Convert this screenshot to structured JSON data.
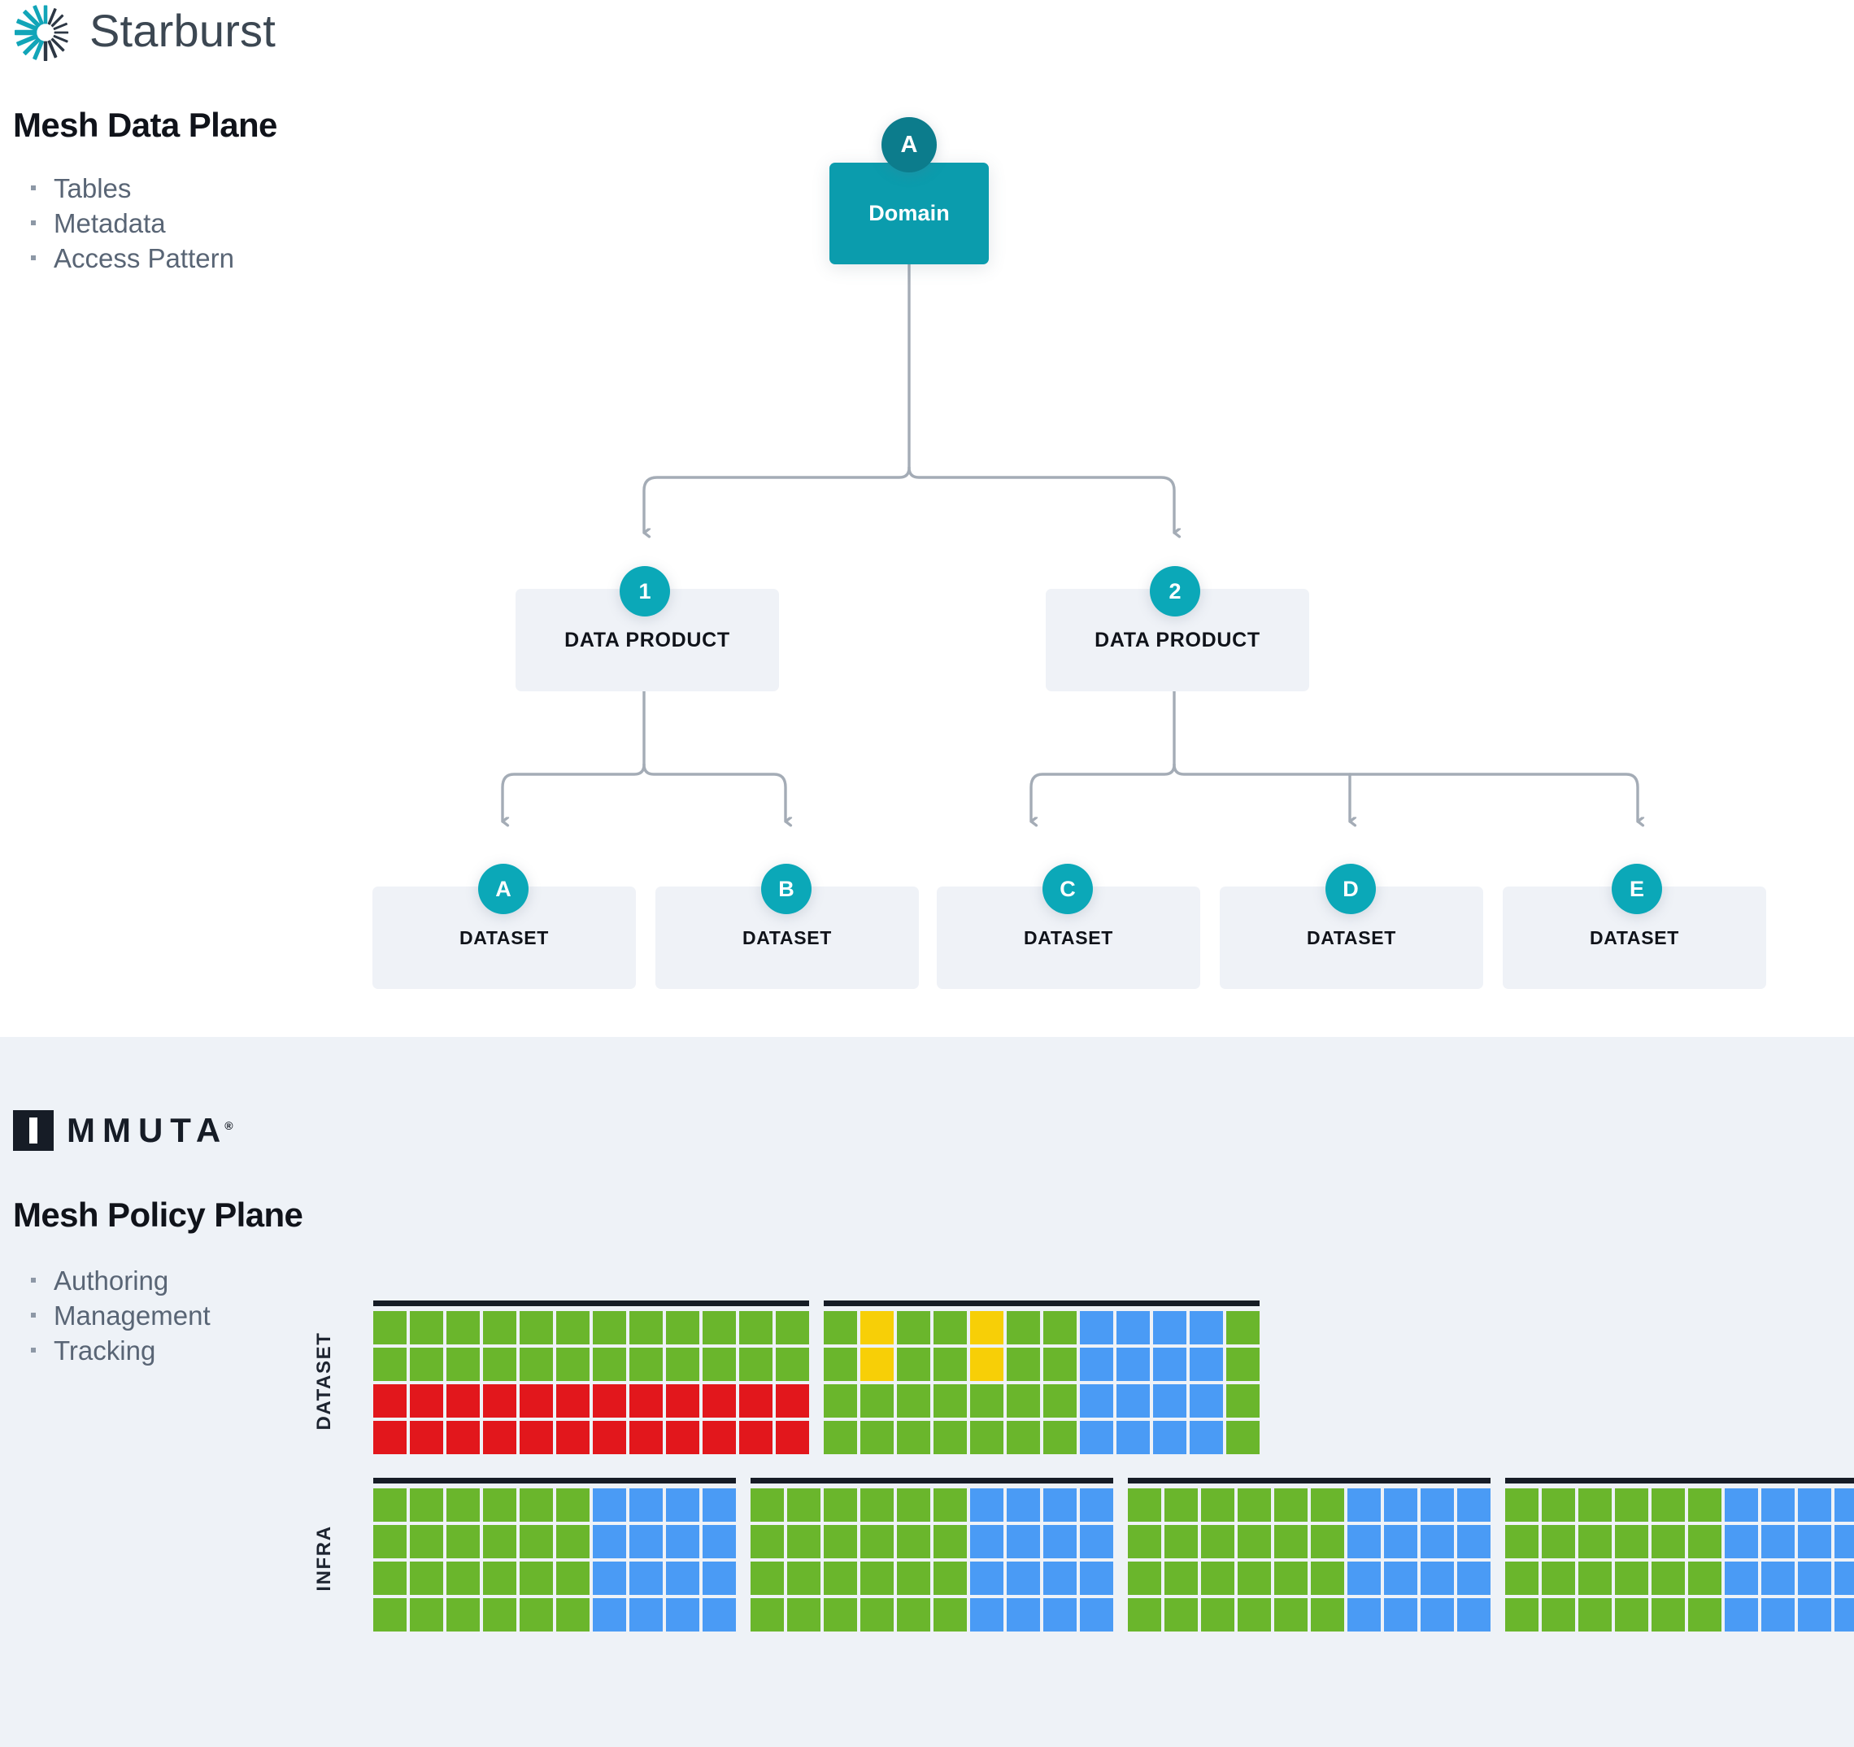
{
  "colors": {
    "teal": "#0b9cad",
    "teal_dark": "#0c7c8c",
    "teal_badge": "#0ba8b8",
    "box_gray": "#eff2f7",
    "section_bg": "#eef2f7",
    "connector": "#a4acb6",
    "green": "#6ab62c",
    "red": "#e2171c",
    "yellow": "#f7cf07",
    "blue": "#4a9bf5",
    "ink": "#161c26"
  },
  "data_plane": {
    "logo": {
      "brand": "Starburst",
      "mark": "starburst-radial-mark"
    },
    "heading": "Mesh Data Plane",
    "bullets": [
      "Tables",
      "Metadata",
      "Access Pattern"
    ],
    "diagram": {
      "domain": {
        "badge": "A",
        "label": "Domain"
      },
      "data_products": [
        {
          "badge": "1",
          "label": "DATA PRODUCT"
        },
        {
          "badge": "2",
          "label": "DATA PRODUCT"
        }
      ],
      "datasets": [
        {
          "badge": "A",
          "label": "DATASET",
          "parent": "1"
        },
        {
          "badge": "B",
          "label": "DATASET",
          "parent": "1"
        },
        {
          "badge": "C",
          "label": "DATASET",
          "parent": "2"
        },
        {
          "badge": "D",
          "label": "DATASET",
          "parent": "2"
        },
        {
          "badge": "E",
          "label": "DATASET",
          "parent": "2"
        }
      ]
    }
  },
  "policy_plane": {
    "logo": {
      "brand": "MMUTA",
      "registered": "®",
      "mark": "immuta-i-block"
    },
    "heading": "Mesh Policy Plane",
    "bullets": [
      "Authoring",
      "Management",
      "Tracking"
    ],
    "matrix": {
      "rows": [
        {
          "label": "DATASET",
          "blocks": [
            {
              "columns": 12,
              "grid": [
                [
                  "green",
                  "green",
                  "green",
                  "green",
                  "green",
                  "green",
                  "green",
                  "green",
                  "green",
                  "green",
                  "green",
                  "green"
                ],
                [
                  "green",
                  "green",
                  "green",
                  "green",
                  "green",
                  "green",
                  "green",
                  "green",
                  "green",
                  "green",
                  "green",
                  "green"
                ],
                [
                  "red",
                  "red",
                  "red",
                  "red",
                  "red",
                  "red",
                  "red",
                  "red",
                  "red",
                  "red",
                  "red",
                  "red"
                ],
                [
                  "red",
                  "red",
                  "red",
                  "red",
                  "red",
                  "red",
                  "red",
                  "red",
                  "red",
                  "red",
                  "red",
                  "red"
                ]
              ]
            },
            {
              "columns": 12,
              "grid": [
                [
                  "green",
                  "yellow",
                  "green",
                  "green",
                  "yellow",
                  "green",
                  "green",
                  "blue",
                  "blue",
                  "blue",
                  "blue",
                  "green"
                ],
                [
                  "green",
                  "yellow",
                  "green",
                  "green",
                  "yellow",
                  "green",
                  "green",
                  "blue",
                  "blue",
                  "blue",
                  "blue",
                  "green"
                ],
                [
                  "green",
                  "green",
                  "green",
                  "green",
                  "green",
                  "green",
                  "green",
                  "blue",
                  "blue",
                  "blue",
                  "blue",
                  "green"
                ],
                [
                  "green",
                  "green",
                  "green",
                  "green",
                  "green",
                  "green",
                  "green",
                  "blue",
                  "blue",
                  "blue",
                  "blue",
                  "green"
                ]
              ]
            }
          ]
        },
        {
          "label": "INFRA",
          "blocks": [
            {
              "columns": 10,
              "grid": [
                [
                  "green",
                  "green",
                  "green",
                  "green",
                  "green",
                  "green",
                  "blue",
                  "blue",
                  "blue",
                  "blue"
                ],
                [
                  "green",
                  "green",
                  "green",
                  "green",
                  "green",
                  "green",
                  "blue",
                  "blue",
                  "blue",
                  "blue"
                ],
                [
                  "green",
                  "green",
                  "green",
                  "green",
                  "green",
                  "green",
                  "blue",
                  "blue",
                  "blue",
                  "blue"
                ],
                [
                  "green",
                  "green",
                  "green",
                  "green",
                  "green",
                  "green",
                  "blue",
                  "blue",
                  "blue",
                  "blue"
                ]
              ]
            },
            {
              "columns": 10,
              "grid": [
                [
                  "green",
                  "green",
                  "green",
                  "green",
                  "green",
                  "green",
                  "blue",
                  "blue",
                  "blue",
                  "blue"
                ],
                [
                  "green",
                  "green",
                  "green",
                  "green",
                  "green",
                  "green",
                  "blue",
                  "blue",
                  "blue",
                  "blue"
                ],
                [
                  "green",
                  "green",
                  "green",
                  "green",
                  "green",
                  "green",
                  "blue",
                  "blue",
                  "blue",
                  "blue"
                ],
                [
                  "green",
                  "green",
                  "green",
                  "green",
                  "green",
                  "green",
                  "blue",
                  "blue",
                  "blue",
                  "blue"
                ]
              ]
            },
            {
              "columns": 10,
              "grid": [
                [
                  "green",
                  "green",
                  "green",
                  "green",
                  "green",
                  "green",
                  "blue",
                  "blue",
                  "blue",
                  "blue"
                ],
                [
                  "green",
                  "green",
                  "green",
                  "green",
                  "green",
                  "green",
                  "blue",
                  "blue",
                  "blue",
                  "blue"
                ],
                [
                  "green",
                  "green",
                  "green",
                  "green",
                  "green",
                  "green",
                  "blue",
                  "blue",
                  "blue",
                  "blue"
                ],
                [
                  "green",
                  "green",
                  "green",
                  "green",
                  "green",
                  "green",
                  "blue",
                  "blue",
                  "blue",
                  "blue"
                ]
              ]
            },
            {
              "columns": 10,
              "grid": [
                [
                  "green",
                  "green",
                  "green",
                  "green",
                  "green",
                  "green",
                  "blue",
                  "blue",
                  "blue",
                  "blue"
                ],
                [
                  "green",
                  "green",
                  "green",
                  "green",
                  "green",
                  "green",
                  "blue",
                  "blue",
                  "blue",
                  "blue"
                ],
                [
                  "green",
                  "green",
                  "green",
                  "green",
                  "green",
                  "green",
                  "blue",
                  "blue",
                  "blue",
                  "blue"
                ],
                [
                  "green",
                  "green",
                  "green",
                  "green",
                  "green",
                  "green",
                  "blue",
                  "blue",
                  "blue",
                  "blue"
                ]
              ]
            }
          ]
        }
      ]
    }
  }
}
